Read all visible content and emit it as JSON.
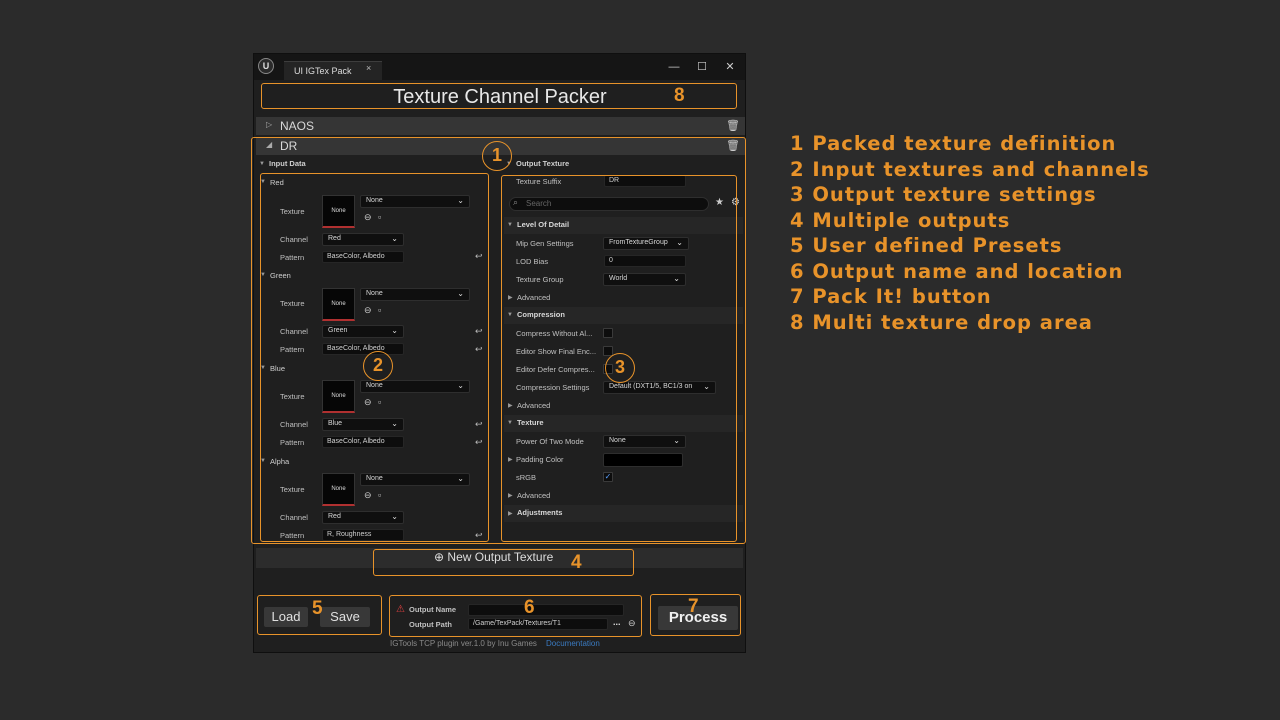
{
  "window": {
    "tab_title": "UI IGTex Pack",
    "tab_close": "×",
    "logo": "U",
    "minimize": "—",
    "maximize": "☐",
    "close": "✕"
  },
  "drop_area": {
    "title": "Texture Channel Packer"
  },
  "sections": [
    {
      "name": "NAOS",
      "expanded": false
    },
    {
      "name": "DR",
      "expanded": true
    }
  ],
  "input_data": {
    "header": "Input Data",
    "row_labels": {
      "texture": "Texture",
      "channel": "Channel",
      "pattern": "Pattern"
    },
    "groups": [
      {
        "name": "Red",
        "texture": "None",
        "thumb": "None",
        "channel": "Red",
        "pattern": "BaseColor, Albedo"
      },
      {
        "name": "Green",
        "texture": "None",
        "thumb": "None",
        "channel": "Green",
        "pattern": "BaseColor, Albedo"
      },
      {
        "name": "Blue",
        "texture": "None",
        "thumb": "None",
        "channel": "Blue",
        "pattern": "BaseColor, Albedo"
      },
      {
        "name": "Alpha",
        "texture": "None",
        "thumb": "None",
        "channel": "Red",
        "pattern": "R, Roughness"
      }
    ]
  },
  "output_texture": {
    "header": "Output Texture",
    "suffix_label": "Texture Suffix",
    "suffix_value": "DR",
    "search_placeholder": "Search",
    "lod": {
      "header": "Level Of Detail",
      "mip_label": "Mip Gen Settings",
      "mip_value": "FromTextureGroup",
      "lod_bias_label": "LOD Bias",
      "lod_bias_value": "0",
      "group_label": "Texture Group",
      "group_value": "World",
      "advanced": "Advanced"
    },
    "compression": {
      "header": "Compression",
      "compress_without_alpha": "Compress Without Al...",
      "editor_show_final": "Editor Show Final Enc...",
      "editor_defer": "Editor Defer Compres...",
      "settings_label": "Compression Settings",
      "settings_value": "Default (DXT1/5, BC1/3 on",
      "advanced": "Advanced"
    },
    "texture": {
      "header": "Texture",
      "pow2_label": "Power Of Two Mode",
      "pow2_value": "None",
      "padding_label": "Padding Color",
      "srgb_label": "sRGB",
      "srgb_checked": true,
      "advanced": "Advanced"
    },
    "adjustments": "Adjustments"
  },
  "new_output": {
    "label": "New Output Texture",
    "icon": "⊕"
  },
  "presets": {
    "load": "Load",
    "save": "Save"
  },
  "output": {
    "name_label": "Output Name",
    "name_value": "",
    "path_label": "Output Path",
    "path_value": "/Game/TexPack/Textures/T1",
    "browse": "...",
    "warning_icon": "⚠"
  },
  "process": {
    "label": "Process"
  },
  "footer": {
    "text": "IGTools TCP plugin ver.1.0 by Inu Games",
    "link": "Documentation"
  },
  "annotations": {
    "numbers": [
      "1",
      "2",
      "3",
      "4",
      "5",
      "6",
      "7",
      "8"
    ],
    "legend": [
      "1 Packed texture definition",
      "2 Input textures and channels",
      "3 Output texture settings",
      "4 Multiple outputs",
      "5 User defined Presets",
      "6 Output name and location",
      "7 Pack It! button",
      "8 Multi texture drop area"
    ],
    "accent_color": "#e8932a"
  }
}
